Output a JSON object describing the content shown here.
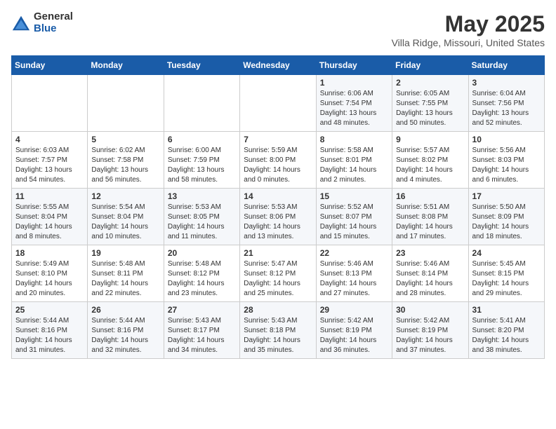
{
  "header": {
    "logo_general": "General",
    "logo_blue": "Blue",
    "month_title": "May 2025",
    "location": "Villa Ridge, Missouri, United States"
  },
  "days_of_week": [
    "Sunday",
    "Monday",
    "Tuesday",
    "Wednesday",
    "Thursday",
    "Friday",
    "Saturday"
  ],
  "weeks": [
    [
      {
        "day": "",
        "info": ""
      },
      {
        "day": "",
        "info": ""
      },
      {
        "day": "",
        "info": ""
      },
      {
        "day": "",
        "info": ""
      },
      {
        "day": "1",
        "info": "Sunrise: 6:06 AM\nSunset: 7:54 PM\nDaylight: 13 hours\nand 48 minutes."
      },
      {
        "day": "2",
        "info": "Sunrise: 6:05 AM\nSunset: 7:55 PM\nDaylight: 13 hours\nand 50 minutes."
      },
      {
        "day": "3",
        "info": "Sunrise: 6:04 AM\nSunset: 7:56 PM\nDaylight: 13 hours\nand 52 minutes."
      }
    ],
    [
      {
        "day": "4",
        "info": "Sunrise: 6:03 AM\nSunset: 7:57 PM\nDaylight: 13 hours\nand 54 minutes."
      },
      {
        "day": "5",
        "info": "Sunrise: 6:02 AM\nSunset: 7:58 PM\nDaylight: 13 hours\nand 56 minutes."
      },
      {
        "day": "6",
        "info": "Sunrise: 6:00 AM\nSunset: 7:59 PM\nDaylight: 13 hours\nand 58 minutes."
      },
      {
        "day": "7",
        "info": "Sunrise: 5:59 AM\nSunset: 8:00 PM\nDaylight: 14 hours\nand 0 minutes."
      },
      {
        "day": "8",
        "info": "Sunrise: 5:58 AM\nSunset: 8:01 PM\nDaylight: 14 hours\nand 2 minutes."
      },
      {
        "day": "9",
        "info": "Sunrise: 5:57 AM\nSunset: 8:02 PM\nDaylight: 14 hours\nand 4 minutes."
      },
      {
        "day": "10",
        "info": "Sunrise: 5:56 AM\nSunset: 8:03 PM\nDaylight: 14 hours\nand 6 minutes."
      }
    ],
    [
      {
        "day": "11",
        "info": "Sunrise: 5:55 AM\nSunset: 8:04 PM\nDaylight: 14 hours\nand 8 minutes."
      },
      {
        "day": "12",
        "info": "Sunrise: 5:54 AM\nSunset: 8:04 PM\nDaylight: 14 hours\nand 10 minutes."
      },
      {
        "day": "13",
        "info": "Sunrise: 5:53 AM\nSunset: 8:05 PM\nDaylight: 14 hours\nand 11 minutes."
      },
      {
        "day": "14",
        "info": "Sunrise: 5:53 AM\nSunset: 8:06 PM\nDaylight: 14 hours\nand 13 minutes."
      },
      {
        "day": "15",
        "info": "Sunrise: 5:52 AM\nSunset: 8:07 PM\nDaylight: 14 hours\nand 15 minutes."
      },
      {
        "day": "16",
        "info": "Sunrise: 5:51 AM\nSunset: 8:08 PM\nDaylight: 14 hours\nand 17 minutes."
      },
      {
        "day": "17",
        "info": "Sunrise: 5:50 AM\nSunset: 8:09 PM\nDaylight: 14 hours\nand 18 minutes."
      }
    ],
    [
      {
        "day": "18",
        "info": "Sunrise: 5:49 AM\nSunset: 8:10 PM\nDaylight: 14 hours\nand 20 minutes."
      },
      {
        "day": "19",
        "info": "Sunrise: 5:48 AM\nSunset: 8:11 PM\nDaylight: 14 hours\nand 22 minutes."
      },
      {
        "day": "20",
        "info": "Sunrise: 5:48 AM\nSunset: 8:12 PM\nDaylight: 14 hours\nand 23 minutes."
      },
      {
        "day": "21",
        "info": "Sunrise: 5:47 AM\nSunset: 8:12 PM\nDaylight: 14 hours\nand 25 minutes."
      },
      {
        "day": "22",
        "info": "Sunrise: 5:46 AM\nSunset: 8:13 PM\nDaylight: 14 hours\nand 27 minutes."
      },
      {
        "day": "23",
        "info": "Sunrise: 5:46 AM\nSunset: 8:14 PM\nDaylight: 14 hours\nand 28 minutes."
      },
      {
        "day": "24",
        "info": "Sunrise: 5:45 AM\nSunset: 8:15 PM\nDaylight: 14 hours\nand 29 minutes."
      }
    ],
    [
      {
        "day": "25",
        "info": "Sunrise: 5:44 AM\nSunset: 8:16 PM\nDaylight: 14 hours\nand 31 minutes."
      },
      {
        "day": "26",
        "info": "Sunrise: 5:44 AM\nSunset: 8:16 PM\nDaylight: 14 hours\nand 32 minutes."
      },
      {
        "day": "27",
        "info": "Sunrise: 5:43 AM\nSunset: 8:17 PM\nDaylight: 14 hours\nand 34 minutes."
      },
      {
        "day": "28",
        "info": "Sunrise: 5:43 AM\nSunset: 8:18 PM\nDaylight: 14 hours\nand 35 minutes."
      },
      {
        "day": "29",
        "info": "Sunrise: 5:42 AM\nSunset: 8:19 PM\nDaylight: 14 hours\nand 36 minutes."
      },
      {
        "day": "30",
        "info": "Sunrise: 5:42 AM\nSunset: 8:19 PM\nDaylight: 14 hours\nand 37 minutes."
      },
      {
        "day": "31",
        "info": "Sunrise: 5:41 AM\nSunset: 8:20 PM\nDaylight: 14 hours\nand 38 minutes."
      }
    ]
  ]
}
